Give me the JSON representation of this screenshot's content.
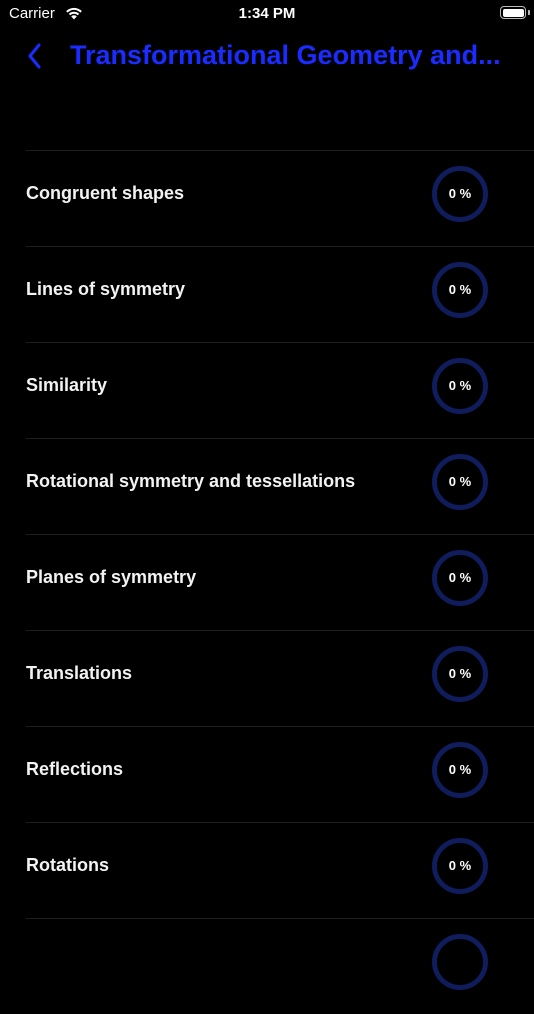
{
  "status_bar": {
    "carrier": "Carrier",
    "time": "1:34 PM"
  },
  "nav": {
    "title": "Transformational Geometry and..."
  },
  "colors": {
    "accent": "#1a2cff",
    "ring_track": "#0f1d5c",
    "background": "#000000",
    "divider": "#1f1f1f"
  },
  "topics": [
    {
      "label": "Congruent shapes",
      "progress_text": "0 %",
      "progress": 0
    },
    {
      "label": "Lines of symmetry",
      "progress_text": "0 %",
      "progress": 0
    },
    {
      "label": "Similarity",
      "progress_text": "0 %",
      "progress": 0
    },
    {
      "label": "Rotational symmetry and tessellations",
      "progress_text": "0 %",
      "progress": 0
    },
    {
      "label": "Planes of symmetry",
      "progress_text": "0 %",
      "progress": 0
    },
    {
      "label": "Translations",
      "progress_text": "0 %",
      "progress": 0
    },
    {
      "label": "Reflections",
      "progress_text": "0 %",
      "progress": 0
    },
    {
      "label": "Rotations",
      "progress_text": "0 %",
      "progress": 0
    }
  ]
}
